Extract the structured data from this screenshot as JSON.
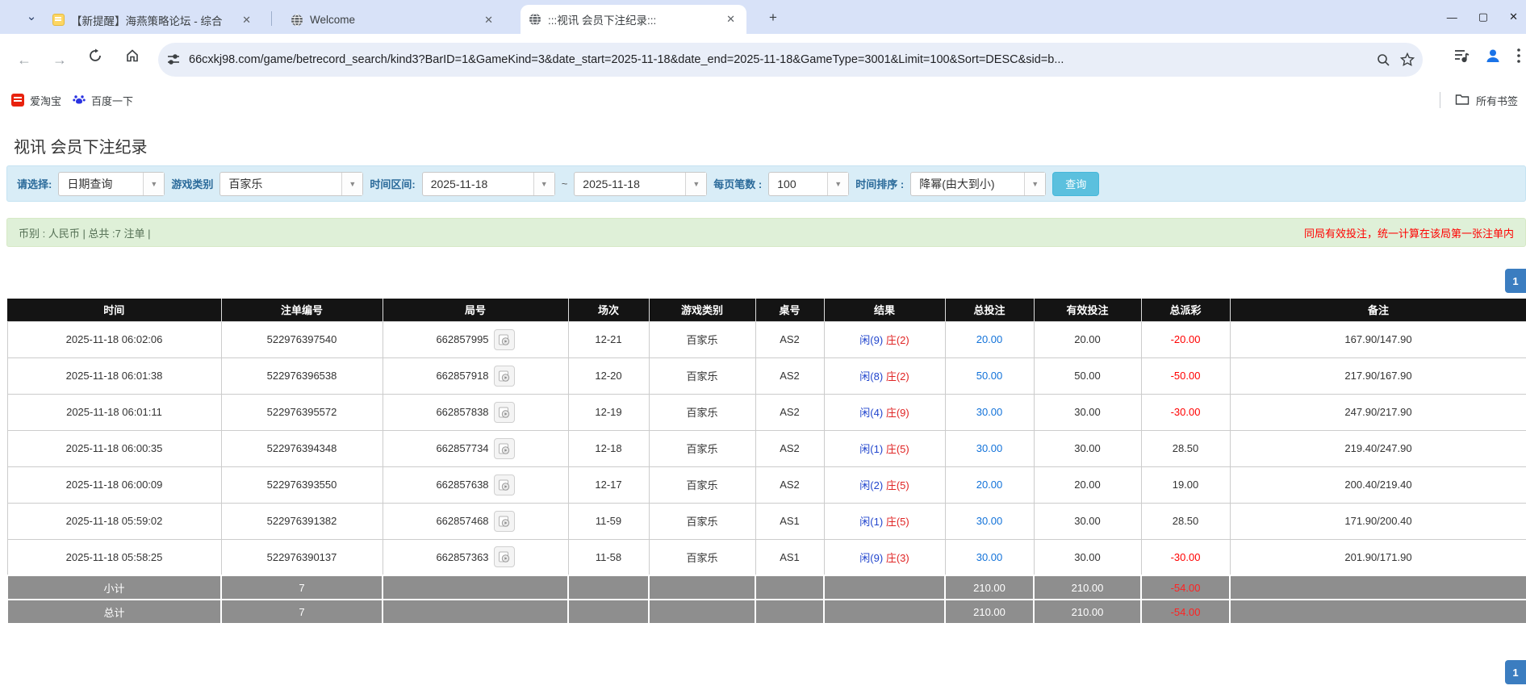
{
  "browser": {
    "tab_search_glyph": "⌄",
    "tabs": [
      {
        "title": "【新提醒】海燕策略论坛 - 综合",
        "close_glyph": "✕"
      },
      {
        "title": "Welcome",
        "close_glyph": "✕"
      },
      {
        "title": ":::视讯 会员下注纪录:::",
        "close_glyph": "✕"
      }
    ],
    "new_tab_glyph": "+",
    "window_controls": {
      "minimize": "—",
      "maximize": "▢",
      "close": "✕"
    },
    "nav": {
      "back": "←",
      "forward": "→"
    },
    "url": "66cxkj98.com/game/betrecord_search/kind3?BarID=1&GameKind=3&date_start=2025-11-18&date_end=2025-11-18&GameType=3001&Limit=100&Sort=DESC&sid=b...",
    "bookmarks": {
      "taobao": "爱淘宝",
      "baidu": "百度一下",
      "all_bookmarks": "所有书签"
    }
  },
  "page": {
    "title": "视讯 会员下注纪录",
    "filters": {
      "select_label": "请选择:",
      "select_value": "日期查询",
      "game_type_label": "游戏类别",
      "game_type_value": "百家乐",
      "date_range_label": "时间区间:",
      "date_start": "2025-11-18",
      "range_separator": "~",
      "date_end": "2025-11-18",
      "per_page_label": "每页笔数 :",
      "per_page_value": "100",
      "sort_label": "时间排序 :",
      "sort_value": "降幂(由大到小)",
      "search_button": "查询",
      "dropdown_arrow": "▼"
    },
    "summary": {
      "left": "币别 : 人民币 | 总共 :7 注单 |",
      "right_note": "同局有效投注，统一计算在该局第一张注单内"
    },
    "pagination": {
      "page": "1"
    },
    "table": {
      "headers": [
        "时间",
        "注单编号",
        "局号",
        "场次",
        "游戏类别",
        "桌号",
        "结果",
        "总投注",
        "有效投注",
        "总派彩",
        "备注"
      ],
      "rows": [
        {
          "time": "2025-11-18 06:02:06",
          "bet_id": "522976397540",
          "round_id": "662857995",
          "session": "12-21",
          "game": "百家乐",
          "table_no": "AS2",
          "result_player": "闲(9)",
          "result_banker": "庄(2)",
          "total_bet": "20.00",
          "valid_bet": "20.00",
          "payout": "-20.00",
          "note": "167.90/147.90"
        },
        {
          "time": "2025-11-18 06:01:38",
          "bet_id": "522976396538",
          "round_id": "662857918",
          "session": "12-20",
          "game": "百家乐",
          "table_no": "AS2",
          "result_player": "闲(8)",
          "result_banker": "庄(2)",
          "total_bet": "50.00",
          "valid_bet": "50.00",
          "payout": "-50.00",
          "note": "217.90/167.90"
        },
        {
          "time": "2025-11-18 06:01:11",
          "bet_id": "522976395572",
          "round_id": "662857838",
          "session": "12-19",
          "game": "百家乐",
          "table_no": "AS2",
          "result_player": "闲(4)",
          "result_banker": "庄(9)",
          "total_bet": "30.00",
          "valid_bet": "30.00",
          "payout": "-30.00",
          "note": "247.90/217.90"
        },
        {
          "time": "2025-11-18 06:00:35",
          "bet_id": "522976394348",
          "round_id": "662857734",
          "session": "12-18",
          "game": "百家乐",
          "table_no": "AS2",
          "result_player": "闲(1)",
          "result_banker": "庄(5)",
          "total_bet": "30.00",
          "valid_bet": "30.00",
          "payout": "28.50",
          "note": "219.40/247.90"
        },
        {
          "time": "2025-11-18 06:00:09",
          "bet_id": "522976393550",
          "round_id": "662857638",
          "session": "12-17",
          "game": "百家乐",
          "table_no": "AS2",
          "result_player": "闲(2)",
          "result_banker": "庄(5)",
          "total_bet": "20.00",
          "valid_bet": "20.00",
          "payout": "19.00",
          "note": "200.40/219.40"
        },
        {
          "time": "2025-11-18 05:59:02",
          "bet_id": "522976391382",
          "round_id": "662857468",
          "session": "11-59",
          "game": "百家乐",
          "table_no": "AS1",
          "result_player": "闲(1)",
          "result_banker": "庄(5)",
          "total_bet": "30.00",
          "valid_bet": "30.00",
          "payout": "28.50",
          "note": "171.90/200.40"
        },
        {
          "time": "2025-11-18 05:58:25",
          "bet_id": "522976390137",
          "round_id": "662857363",
          "session": "11-58",
          "game": "百家乐",
          "table_no": "AS1",
          "result_player": "闲(9)",
          "result_banker": "庄(3)",
          "total_bet": "30.00",
          "valid_bet": "30.00",
          "payout": "-30.00",
          "note": "201.90/171.90"
        }
      ],
      "subtotal": {
        "label": "小计",
        "count": "7",
        "total_bet": "210.00",
        "valid_bet": "210.00",
        "payout": "-54.00"
      },
      "total": {
        "label": "总计",
        "count": "7",
        "total_bet": "210.00",
        "valid_bet": "210.00",
        "payout": "-54.00"
      }
    },
    "colors": {
      "accent_blue": "#1272d9",
      "player_blue": "#2145cd",
      "banker_red": "#e02424",
      "loss_red": "#ff0000",
      "filter_bg": "#d9edf7",
      "summary_bg": "#dff0d8",
      "header_bg": "#141414",
      "footer_gray": "#8e8e8e",
      "page_btn_blue": "#3b7dc0"
    }
  }
}
